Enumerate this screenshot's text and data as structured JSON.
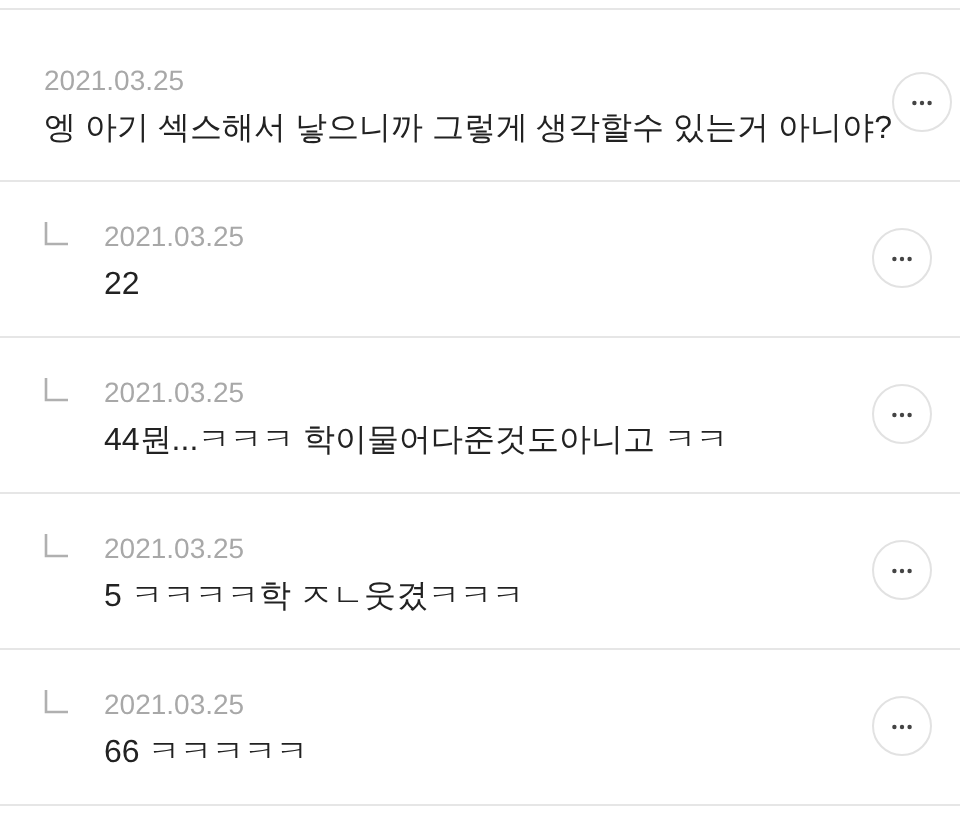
{
  "comments": [
    {
      "kind": "comment",
      "date": "2021.03.25",
      "text": "엥 아기 섹스해서 낳으니까 그렇게 생각할수 있는거 아니야?"
    },
    {
      "kind": "reply",
      "date": "2021.03.25",
      "text": "22"
    },
    {
      "kind": "reply",
      "date": "2021.03.25",
      "text": "44뭔...ㅋㅋㅋ 학이물어다준것도아니고 ㅋㅋ"
    },
    {
      "kind": "reply",
      "date": "2021.03.25",
      "text": "5 ㅋㅋㅋㅋ학 ㅈㄴ웃겼ㅋㅋㅋ"
    },
    {
      "kind": "reply",
      "date": "2021.03.25",
      "text": "66 ㅋㅋㅋㅋㅋ"
    }
  ]
}
